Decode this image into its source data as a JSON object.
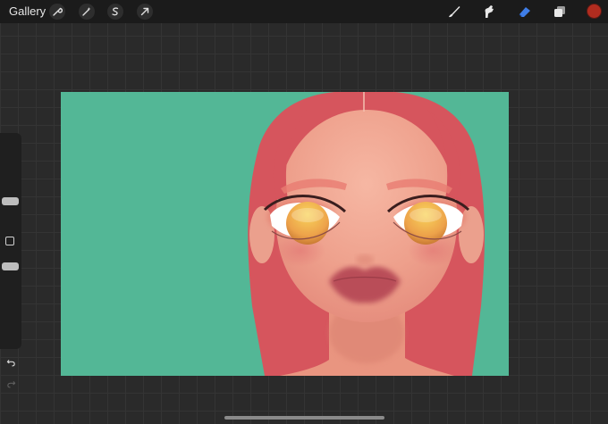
{
  "topbar": {
    "gallery_label": "Gallery",
    "left_tools": [
      "wrench-icon",
      "magic-wand-icon",
      "selection-icon",
      "transform-arrow-icon"
    ],
    "right_tools": [
      "brush-icon",
      "smudge-icon",
      "eraser-icon",
      "layers-icon"
    ],
    "active_tool": "eraser-icon",
    "current_color": "#b12c1f"
  },
  "sidebar": {
    "controls": [
      "brush-size-slider",
      "modify-button",
      "opacity-slider",
      "undo-icon",
      "redo-icon"
    ]
  },
  "canvas": {
    "background_color": "#53b796",
    "artwork": "portrait-illustration"
  }
}
